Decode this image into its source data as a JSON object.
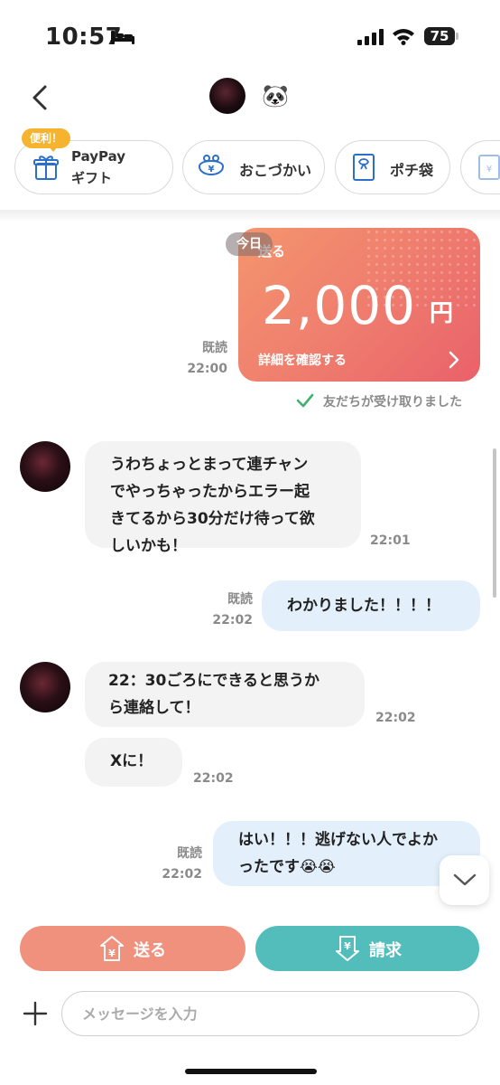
{
  "status_bar": {
    "time": "10:57",
    "battery": "75"
  },
  "header": {
    "contact_emoji": "🐼"
  },
  "services": {
    "badge": "便利！",
    "paypay_gift": {
      "line1": "PayPay",
      "line2": "ギフト"
    },
    "okozukai": "おこづかい",
    "pochibukuro": "ポチ袋"
  },
  "transfer_card": {
    "date_pill": "今日",
    "label": "送る",
    "amount": "2,000",
    "currency": "円",
    "details_link": "詳細を確認する",
    "read": "既読",
    "time": "22:00",
    "received_status": "友だちが受け取りました"
  },
  "messages": [
    {
      "direction": "in",
      "lines": [
        "うわちょっとまって連チャン",
        "でやっちゃったからエラー起",
        "きてるから30分だけ待って欲",
        "しいかも！"
      ],
      "time": "22:01"
    },
    {
      "direction": "out",
      "lines": [
        "わかりました！！！！"
      ],
      "read": "既読",
      "time": "22:02"
    },
    {
      "direction": "in",
      "lines": [
        "22：30ごろにできると思うか",
        "ら連絡して！"
      ],
      "time": "22:02"
    },
    {
      "direction": "in",
      "lines": [
        "Xに！"
      ],
      "time": "22:02"
    },
    {
      "direction": "out",
      "lines": [
        "はい！！！逃げない人でよか",
        "ったです😭😭"
      ],
      "read": "既読",
      "time": "22:02"
    }
  ],
  "actions": {
    "send": "送る",
    "request": "請求"
  },
  "composer": {
    "placeholder": "メッセージを入力"
  },
  "colors": {
    "send": "#f0917e",
    "request": "#52bdbb",
    "outgoing_bubble": "#e3f0fc",
    "incoming_bubble": "#f3f3f3",
    "check": "#3cb371"
  }
}
